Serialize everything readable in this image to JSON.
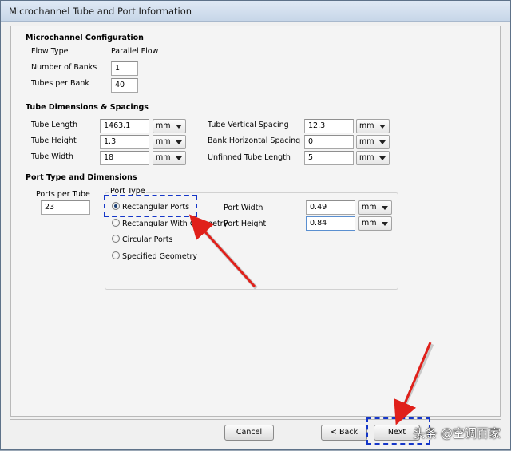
{
  "window": {
    "title": "Microchannel Tube and Port Information"
  },
  "config": {
    "heading": "Microchannel Configuration",
    "flow_type_label": "Flow Type",
    "flow_type_value": "Parallel Flow",
    "banks_label": "Number of Banks",
    "banks_value": "1",
    "tubes_label": "Tubes per Bank",
    "tubes_value": "40"
  },
  "dims": {
    "heading": "Tube Dimensions & Spacings",
    "tube_length_label": "Tube Length",
    "tube_length_value": "1463.1",
    "tube_length_unit": "mm",
    "tube_height_label": "Tube Height",
    "tube_height_value": "1.3",
    "tube_height_unit": "mm",
    "tube_width_label": "Tube Width",
    "tube_width_value": "18",
    "tube_width_unit": "mm",
    "vert_spacing_label": "Tube Vertical Spacing",
    "vert_spacing_value": "12.3",
    "vert_spacing_unit": "mm",
    "horiz_spacing_label": "Bank Horizontal Spacing",
    "horiz_spacing_value": "0",
    "horiz_spacing_unit": "mm",
    "unfinned_label": "Unfinned Tube Length",
    "unfinned_value": "5",
    "unfinned_unit": "mm"
  },
  "ports": {
    "heading": "Port Type and Dimensions",
    "ports_per_tube_label": "Ports per Tube",
    "ports_per_tube_value": "23",
    "port_type_label": "Port Type",
    "options": [
      "Rectangular Ports",
      "Rectangular With Geometry",
      "Circular Ports",
      "Specified Geometry"
    ],
    "selected": "Rectangular Ports",
    "width_label": "Port Width",
    "width_value": "0.49",
    "width_unit": "mm",
    "height_label": "Port Height",
    "height_value": "0.84",
    "height_unit": "mm"
  },
  "buttons": {
    "cancel": "Cancel",
    "back": "< Back",
    "next": "Next"
  },
  "watermark": "头条 @空调百家",
  "colors": {
    "annotation_box": "#1436c8",
    "arrow": "#e0201a"
  }
}
